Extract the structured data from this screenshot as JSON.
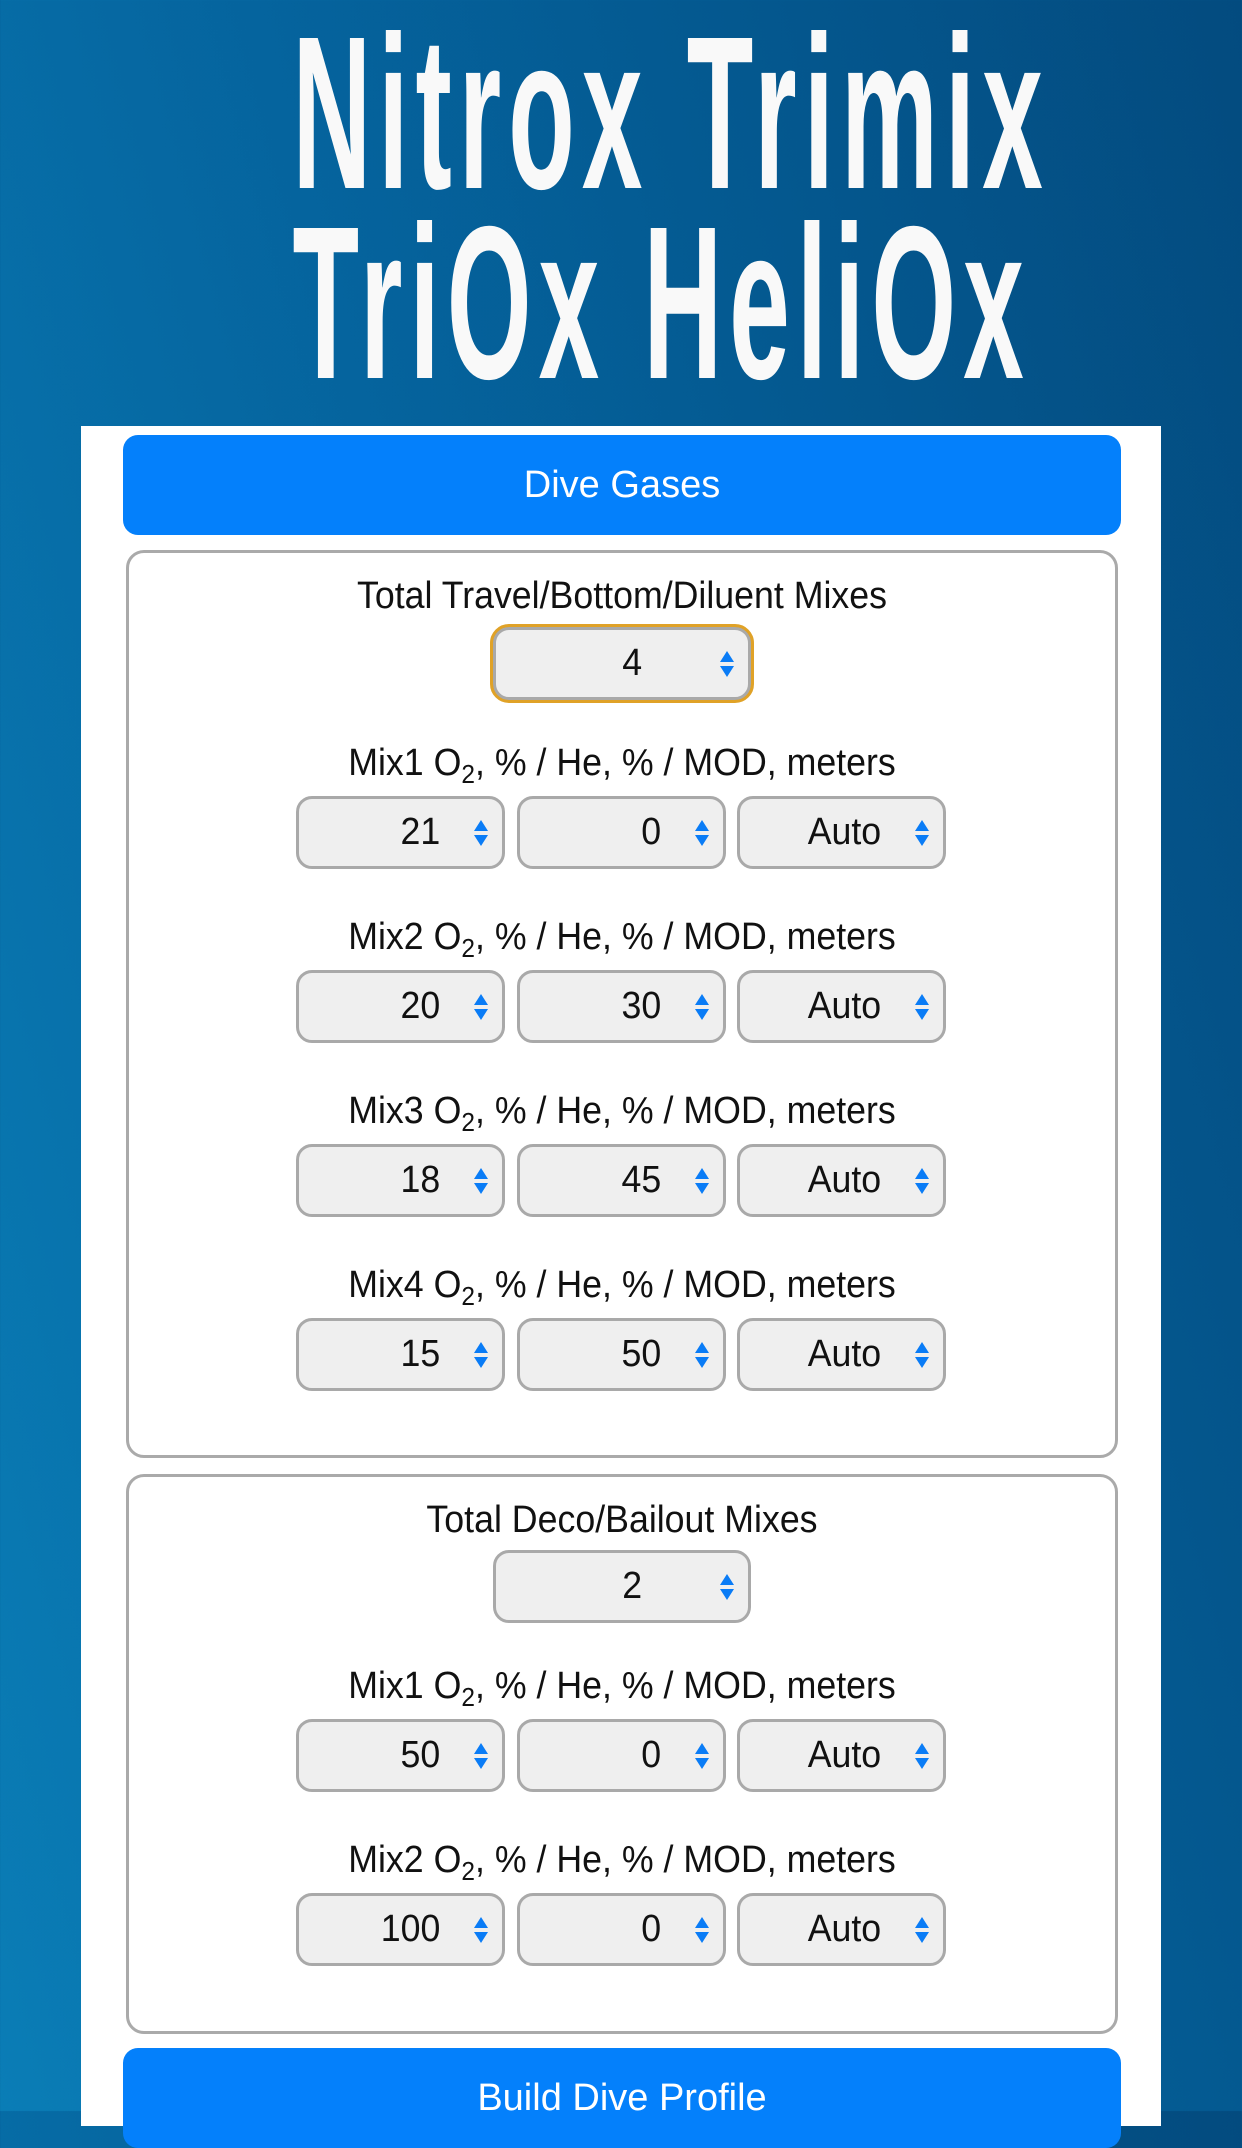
{
  "header": {
    "title_line_1": "Nitrox Trimix",
    "title_line_2": "TriOx HeliOx"
  },
  "dive_gases_button": "Dive Gases",
  "bottom_mixes": {
    "total_label": "Total Travel/Bottom/Diluent Mixes",
    "total_value": "4",
    "mixes": [
      {
        "label_prefix": "Mix1 O",
        "label_sub": "2",
        "label_suffix": ", % / He, % / MOD, meters",
        "o2": "21",
        "he": "0",
        "mod": "Auto"
      },
      {
        "label_prefix": "Mix2 O",
        "label_sub": "2",
        "label_suffix": ", % / He, % / MOD, meters",
        "o2": "20",
        "he": "30",
        "mod": "Auto"
      },
      {
        "label_prefix": "Mix3 O",
        "label_sub": "2",
        "label_suffix": ", % / He, % / MOD, meters",
        "o2": "18",
        "he": "45",
        "mod": "Auto"
      },
      {
        "label_prefix": "Mix4 O",
        "label_sub": "2",
        "label_suffix": ", % / He, % / MOD, meters",
        "o2": "15",
        "he": "50",
        "mod": "Auto"
      }
    ]
  },
  "deco_mixes": {
    "total_label": "Total Deco/Bailout Mixes",
    "total_value": "2",
    "mixes": [
      {
        "label_prefix": "Mix1 O",
        "label_sub": "2",
        "label_suffix": ", % / He, % / MOD, meters",
        "o2": "50",
        "he": "0",
        "mod": "Auto"
      },
      {
        "label_prefix": "Mix2 O",
        "label_sub": "2",
        "label_suffix": ", % / He, % / MOD, meters",
        "o2": "100",
        "he": "0",
        "mod": "Auto"
      }
    ]
  },
  "build_profile_button": "Build Dive Profile",
  "colors": {
    "accent_button": "#0480fb",
    "focus_outline": "#e0a227",
    "select_arrow": "#0a7cf6",
    "background_light": "#0a7db6",
    "background_dark": "#034b7f"
  },
  "icons": {
    "select_arrow": "up-down-chevron-icon"
  }
}
